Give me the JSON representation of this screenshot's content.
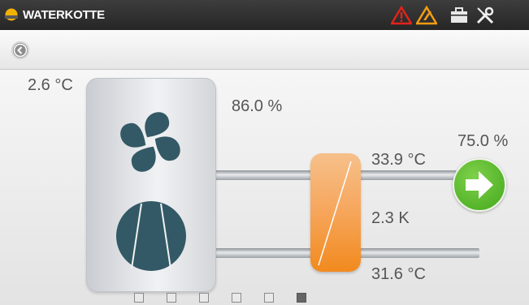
{
  "header": {
    "title": "WATERKOTTE",
    "icons": [
      "logo-icon",
      "warning-icon",
      "service-warning-icon",
      "toolbox-icon",
      "tools-icon"
    ],
    "colors": {
      "warning": "#e2231a",
      "service": "#f39c12"
    }
  },
  "nav": {
    "back_icon": "back-arrow-icon"
  },
  "values": {
    "outdoor_temp": "2.6 °C",
    "fan_speed": "86.0 %",
    "pump_output": "75.0 %",
    "flow_temp": "33.9 °C",
    "delta_t": "2.3 K",
    "return_temp": "31.6 °C"
  },
  "components": {
    "fan_icon": "fan-icon",
    "compressor_icon": "compressor-icon",
    "heat_exchanger": "heat-exchanger",
    "arrow_button": "arrow-right-icon"
  },
  "pager": {
    "count": 6,
    "active_index": 5
  }
}
